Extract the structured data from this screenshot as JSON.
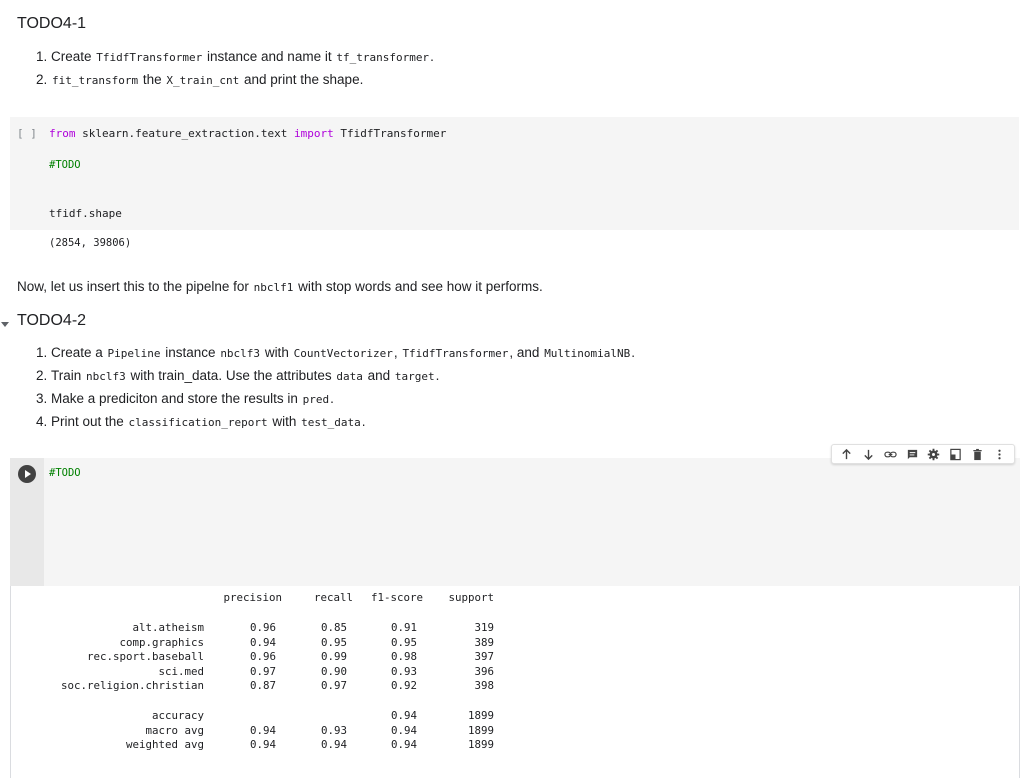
{
  "section1": {
    "title": "TODO4-1",
    "steps": [
      {
        "before": "Create ",
        "code1": "TfidfTransformer",
        "middle": " instance and name it ",
        "code2": "tf_transformer",
        "after": "."
      },
      {
        "before": "",
        "code1": "fit_transform",
        "middle": " the ",
        "code2": "X_train_cnt",
        "after": " and print the shape."
      }
    ]
  },
  "cell1": {
    "bracket": "[ ]",
    "line1_kw1": "from",
    "line1_mod": " sklearn.feature_extraction.text ",
    "line1_kw2": "import",
    "line1_name": " TfidfTransformer",
    "comment": "#TODO",
    "line3": "tfidf.shape",
    "output": "(2854, 39806)"
  },
  "paragraph": {
    "before": "Now, let us insert this to the pipelne for ",
    "code": "nbclf1",
    "after": " with stop words and see how it performs."
  },
  "section2": {
    "title": "TODO4-2",
    "steps": [
      {
        "parts": [
          [
            "t",
            "Create a "
          ],
          [
            "c",
            "Pipeline"
          ],
          [
            "t",
            " instance "
          ],
          [
            "c",
            "nbclf3"
          ],
          [
            "t",
            " with "
          ],
          [
            "c",
            "CountVectorizer"
          ],
          [
            "t",
            ", "
          ],
          [
            "c",
            "TfidfTransformer"
          ],
          [
            "t",
            ", and "
          ],
          [
            "c",
            "MultinomialNB"
          ],
          [
            "t",
            "."
          ]
        ]
      },
      {
        "parts": [
          [
            "t",
            "Train "
          ],
          [
            "c",
            "nbclf3"
          ],
          [
            "t",
            " with train_data. Use the attributes "
          ],
          [
            "c",
            "data"
          ],
          [
            "t",
            " and "
          ],
          [
            "c",
            "target"
          ],
          [
            "t",
            "."
          ]
        ]
      },
      {
        "parts": [
          [
            "t",
            "Make a prediciton and store the results in "
          ],
          [
            "c",
            "pred"
          ],
          [
            "t",
            "."
          ]
        ]
      },
      {
        "parts": [
          [
            "t",
            "Print out the "
          ],
          [
            "c",
            "classification_report"
          ],
          [
            "t",
            " with "
          ],
          [
            "c",
            "test_data"
          ],
          [
            "t",
            "."
          ]
        ]
      }
    ]
  },
  "cell2": {
    "comment": "#TODO"
  },
  "toolbar": {
    "icons": [
      "arrow-up-icon",
      "arrow-down-icon",
      "link-icon",
      "comment-icon",
      "settings-icon",
      "mirror-cell-icon",
      "delete-icon",
      "more-vert-icon"
    ]
  },
  "report": {
    "headers": [
      "precision",
      "recall",
      "f1-score",
      "support"
    ],
    "classes": [
      {
        "label": "alt.atheism",
        "precision": "0.96",
        "recall": "0.85",
        "f1": "0.91",
        "support": "319"
      },
      {
        "label": "comp.graphics",
        "precision": "0.94",
        "recall": "0.95",
        "f1": "0.95",
        "support": "389"
      },
      {
        "label": "rec.sport.baseball",
        "precision": "0.96",
        "recall": "0.99",
        "f1": "0.98",
        "support": "397"
      },
      {
        "label": "sci.med",
        "precision": "0.97",
        "recall": "0.90",
        "f1": "0.93",
        "support": "396"
      },
      {
        "label": "soc.religion.christian",
        "precision": "0.87",
        "recall": "0.97",
        "f1": "0.92",
        "support": "398"
      }
    ],
    "summary": [
      {
        "label": "accuracy",
        "precision": "",
        "recall": "",
        "f1": "0.94",
        "support": "1899"
      },
      {
        "label": "macro avg",
        "precision": "0.94",
        "recall": "0.93",
        "f1": "0.94",
        "support": "1899"
      },
      {
        "label": "weighted avg",
        "precision": "0.94",
        "recall": "0.94",
        "f1": "0.94",
        "support": "1899"
      }
    ]
  }
}
